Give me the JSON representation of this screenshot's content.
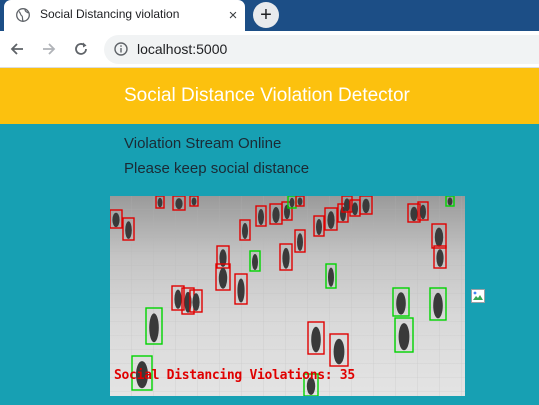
{
  "browser": {
    "tab_title": "Social Distancing violation",
    "tab_close": "×",
    "new_tab": "+",
    "url": "localhost:5000"
  },
  "page": {
    "heading": "Social Distance Violation Detector",
    "status_line_1": "Violation Stream Online",
    "status_line_2": "Please keep social distance"
  },
  "stream": {
    "overlay_text": "Social Distancing Violations: 35",
    "violation_count": 35,
    "colors": {
      "violation_box": "#e00000",
      "safe_box": "#00d400"
    }
  },
  "colors": {
    "tabstrip": "#1c4e86",
    "header": "#fcc10e",
    "content": "#17a0b3"
  }
}
